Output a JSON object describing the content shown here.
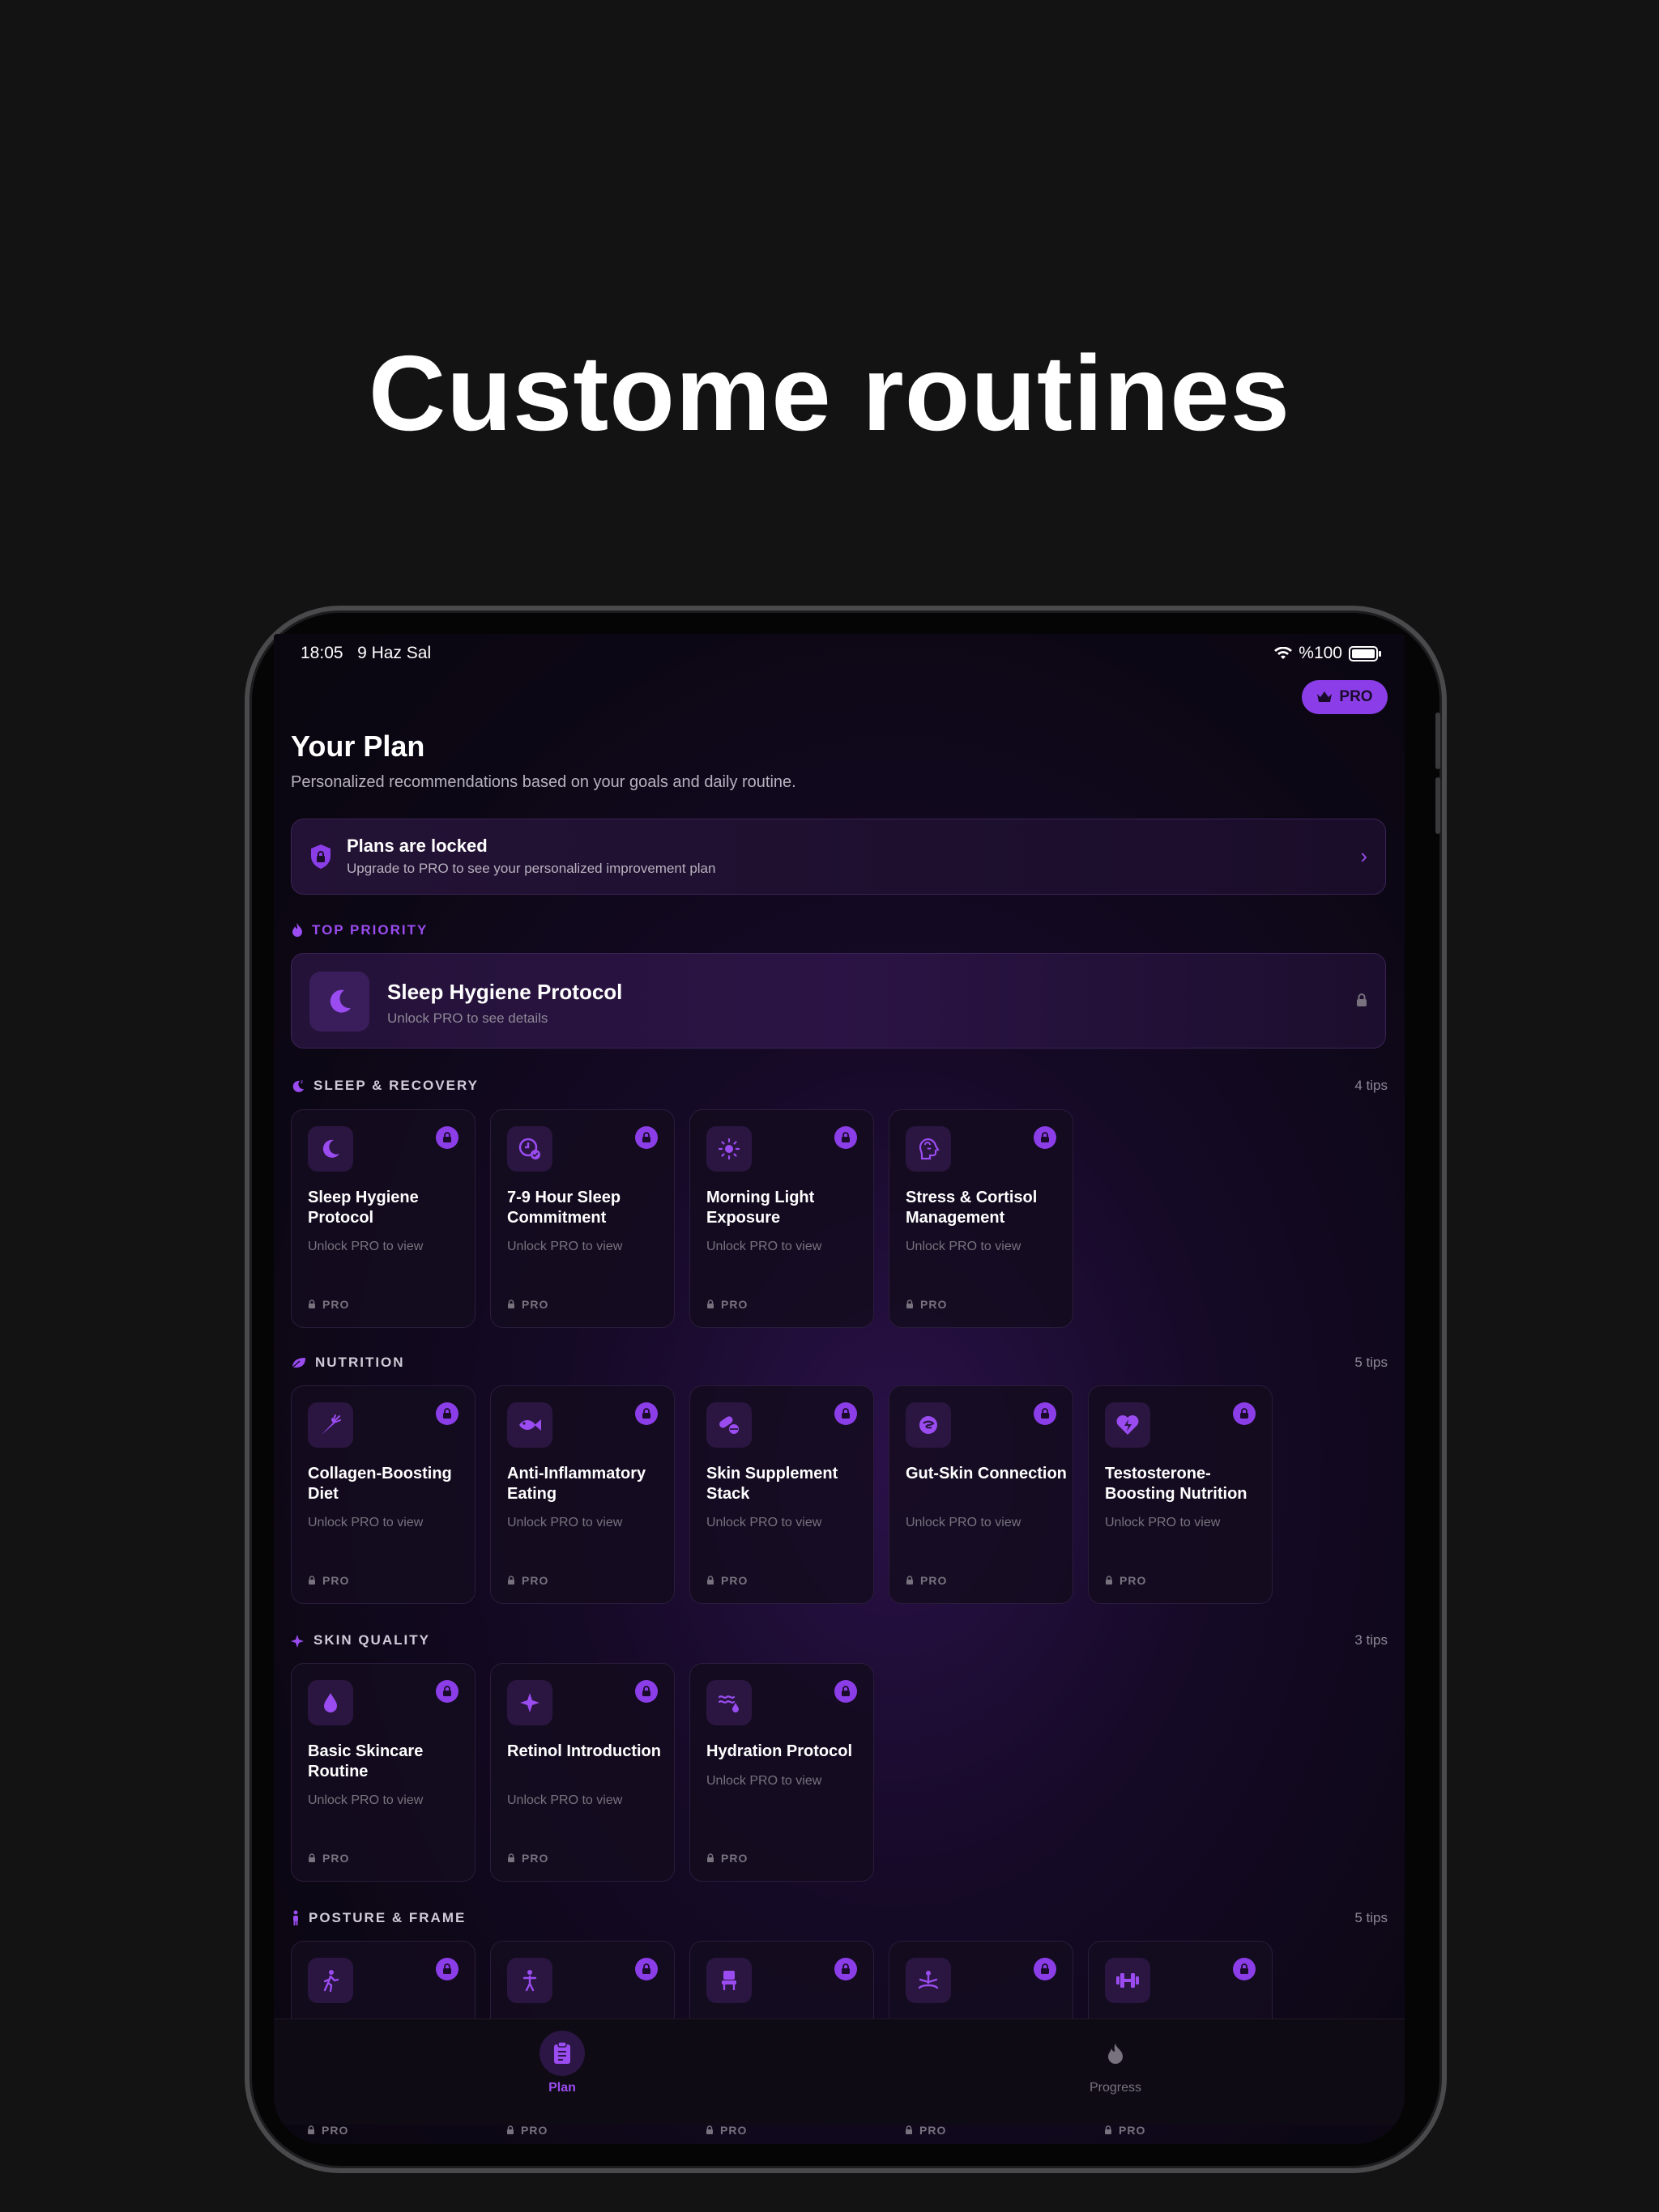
{
  "headline": "Custome routines",
  "status": {
    "time": "18:05",
    "date": "9 Haz Sal",
    "battery": "%100"
  },
  "header": {
    "pro_label": "PRO",
    "title": "Your Plan",
    "subtitle": "Personalized recommendations based on your goals and daily routine."
  },
  "locked_banner": {
    "title": "Plans are locked",
    "text": "Upgrade to PRO to see your personalized improvement plan"
  },
  "top_priority": {
    "label": "TOP PRIORITY",
    "title": "Sleep Hygiene Protocol",
    "subtitle": "Unlock PRO to see details"
  },
  "common": {
    "unlock": "Unlock PRO to view",
    "pro": "PRO"
  },
  "sections": [
    {
      "label": "SLEEP & RECOVERY",
      "count": "4 tips",
      "items": [
        "Sleep Hygiene Protocol",
        "7-9 Hour Sleep Commitment",
        "Morning Light Exposure",
        "Stress & Cortisol Management"
      ]
    },
    {
      "label": "NUTRITION",
      "count": "5 tips",
      "items": [
        "Collagen-Boosting Diet",
        "Anti-Inflammatory Eating",
        "Skin Supplement Stack",
        "Gut-Skin Connection",
        "Testosterone-Boosting Nutrition"
      ]
    },
    {
      "label": "SKIN QUALITY",
      "count": "3 tips",
      "items": [
        "Basic Skincare Routine",
        "Retinol Introduction",
        "Hydration Protocol"
      ]
    },
    {
      "label": "POSTURE & FRAME",
      "count": "5 tips",
      "items": []
    }
  ],
  "tabs": {
    "plan": "Plan",
    "progress": "Progress"
  },
  "colors": {
    "accent": "#8b3ee8",
    "background": "#131313"
  }
}
